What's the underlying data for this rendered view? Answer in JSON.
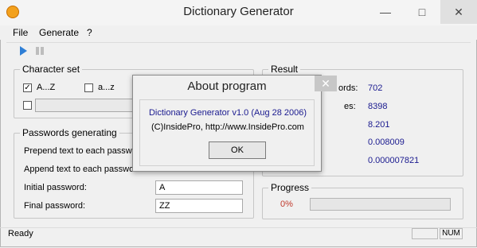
{
  "window": {
    "title": "Dictionary Generator",
    "minimize": "—",
    "maximize": "□",
    "close": "✕"
  },
  "menu": {
    "file": "File",
    "generate": "Generate",
    "help": "?"
  },
  "toolbar": {
    "play_icon": "play-icon",
    "pause_icon": "pause-icon"
  },
  "charset": {
    "title": "Character set",
    "upper_label": "A...Z",
    "upper_checked": "✓",
    "lower_label": "a...z",
    "custom_value": ""
  },
  "passwords": {
    "title": "Passwords generating",
    "prepend_label": "Prepend text to each passwo",
    "append_label": "Append text to each passwo",
    "initial_label": "Initial password:",
    "initial_value": "A",
    "final_label": "Final password:",
    "final_value": "ZZ"
  },
  "result": {
    "title": "Result",
    "row1_label": "ords:",
    "row1_value": "702",
    "row2_label": "es:",
    "row2_value": "8398",
    "row3_value": "8.201",
    "row4_value": "0.008009",
    "row5_value": "0.000007821"
  },
  "progress": {
    "title": "Progress",
    "percent_label": "0%",
    "fraction": 0
  },
  "status": {
    "text": "Ready",
    "num": "NUM"
  },
  "about": {
    "title": "About program",
    "line1": "Dictionary Generator v1.0 (Aug 28 2006)",
    "line2": "(C)InsidePro, http://www.InsidePro.com",
    "ok": "OK",
    "close": "✕"
  }
}
